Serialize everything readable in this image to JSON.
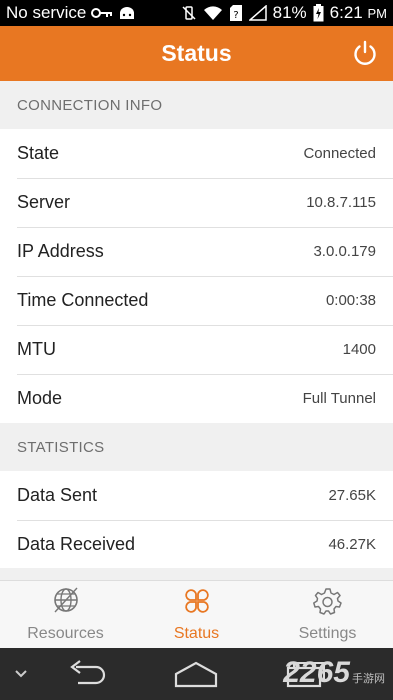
{
  "statusbar": {
    "carrier": "No service",
    "battery": "81%",
    "time": "6:21",
    "ampm": "PM"
  },
  "appbar": {
    "title": "Status"
  },
  "connection": {
    "header": "CONNECTION INFO",
    "rows": [
      {
        "label": "State",
        "value": "Connected"
      },
      {
        "label": "Server",
        "value": "10.8.7.115"
      },
      {
        "label": "IP Address",
        "value": "3.0.0.179"
      },
      {
        "label": "Time Connected",
        "value": "0:00:38"
      },
      {
        "label": "MTU",
        "value": "1400"
      },
      {
        "label": "Mode",
        "value": "Full Tunnel"
      }
    ]
  },
  "statistics": {
    "header": "STATISTICS",
    "rows": [
      {
        "label": "Data Sent",
        "value": "27.65K"
      },
      {
        "label": "Data Received",
        "value": "46.27K"
      }
    ]
  },
  "tabs": [
    {
      "label": "Resources",
      "icon": "globe-icon",
      "active": false
    },
    {
      "label": "Status",
      "icon": "clover-icon",
      "active": true
    },
    {
      "label": "Settings",
      "icon": "gear-icon",
      "active": false
    }
  ],
  "colors": {
    "accent": "#e87722",
    "background": "#f0f0f0",
    "statusbar": "#000000",
    "navbar": "#2b2b2b"
  },
  "watermark": {
    "main": "2265",
    "sub": "手游网"
  }
}
